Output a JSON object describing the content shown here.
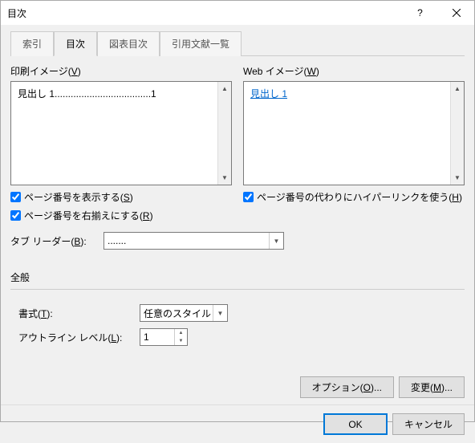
{
  "title": "目次",
  "tabs": [
    "索引",
    "目次",
    "図表目次",
    "引用文献一覧"
  ],
  "print_preview": {
    "label": "印刷イメージ(",
    "accel": "V",
    "label_end": ")",
    "content": "見出し 1....................................1"
  },
  "web_preview": {
    "label": "Web イメージ(",
    "accel": "W",
    "label_end": ")",
    "content": "見出し 1"
  },
  "show_page_numbers": {
    "label": "ページ番号を表示する(",
    "accel": "S",
    "label_end": ")"
  },
  "right_align": {
    "label": "ページ番号を右揃えにする(",
    "accel": "R",
    "label_end": ")"
  },
  "use_hyperlinks": {
    "label": "ページ番号の代わりにハイパーリンクを使う(",
    "accel": "H",
    "label_end": ")"
  },
  "tab_leader": {
    "label": "タブ リーダー(",
    "accel": "B",
    "label_end": "):",
    "value": "......."
  },
  "general_label": "全般",
  "formats": {
    "label": "書式(",
    "accel": "T",
    "label_end": "):",
    "value": "任意のスタイル"
  },
  "outline_levels": {
    "label": "アウトライン レベル(",
    "accel": "L",
    "label_end": "):",
    "value": "1"
  },
  "buttons": {
    "options": "オプション(",
    "options_accel": "O",
    "options_end": ")...",
    "modify": "変更(",
    "modify_accel": "M",
    "modify_end": ")...",
    "ok": "OK",
    "cancel": "キャンセル"
  }
}
